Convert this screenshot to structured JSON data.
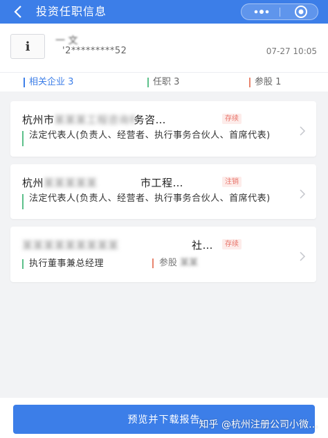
{
  "header": {
    "title": "投资任职信息",
    "back_icon": "back-chevron-icon",
    "more_icon": "more-dots-icon",
    "target_icon": "target-icon"
  },
  "person": {
    "avatar_char": "i",
    "name": "一 文",
    "id_masked": "'2*********52",
    "time": "07-27 10:05"
  },
  "tabs": [
    {
      "label": "相关企业 3",
      "color": "#3c7ee8"
    },
    {
      "label": "任职 3",
      "color": "#5cc08a"
    },
    {
      "label": "参股 1",
      "color": "#e8846e"
    }
  ],
  "companies": [
    {
      "name_prefix": "杭州市",
      "name_hidden": "某某某工程咨询有限公司",
      "name_suffix": "务咨…",
      "status": "存续",
      "role": "法定代表人(负责人、经营者、执行事务合伙人、首席代表)"
    },
    {
      "name_prefix": "杭州",
      "name_hidden": "某某某某某",
      "name_suffix": "市工程…",
      "status": "注销",
      "role": "法定代表人(负责人、经营者、执行事务合伙人、首席代表)"
    },
    {
      "name_prefix": "",
      "name_hidden": "某某某某某某某某某",
      "name_suffix": "社…",
      "status": "存续",
      "role": "执行董事兼总经理",
      "holding_label": "参股",
      "holding_hidden": "某某"
    }
  ],
  "footer": {
    "button_label": "预览并下载报告",
    "watermark": "知乎 @杭州注册公司小微…"
  }
}
